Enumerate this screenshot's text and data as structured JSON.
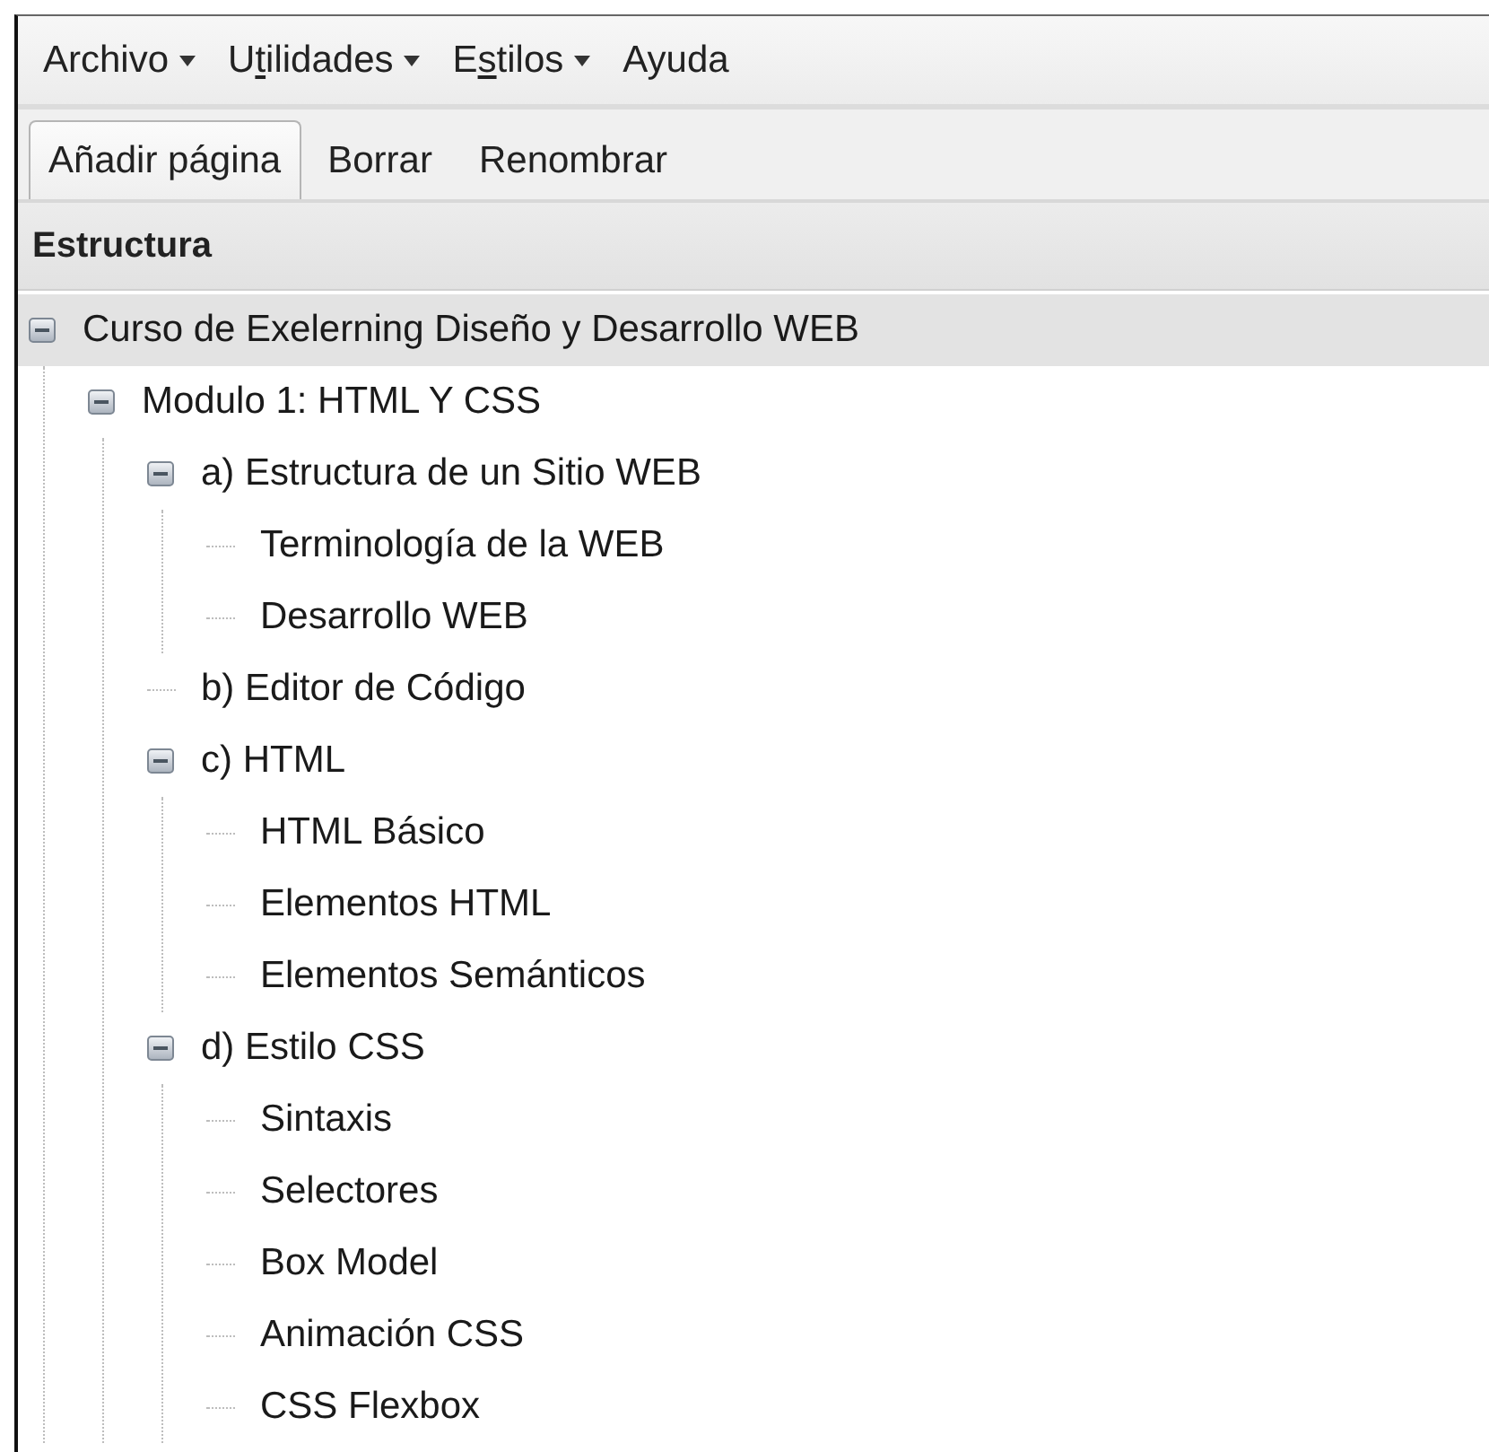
{
  "menu_bar": [
    {
      "label": "Archivo",
      "has_dropdown": true
    },
    {
      "label": "U",
      "mnemonic": "t",
      "label_rest": "ilidades",
      "has_dropdown": true
    },
    {
      "label": "E",
      "mnemonic": "s",
      "label_rest": "tilos",
      "has_dropdown": true
    },
    {
      "label": "Ayuda",
      "has_dropdown": false
    }
  ],
  "toolbar": [
    {
      "label": "Añadir página",
      "selected": true
    },
    {
      "label": "Borrar",
      "selected": false
    },
    {
      "label": "Renombrar",
      "selected": false
    }
  ],
  "panel": {
    "title": "Estructura"
  },
  "tree": [
    {
      "label": "Curso de Exelerning Diseño y Desarrollo WEB",
      "selected": true,
      "expanded": true,
      "children": [
        {
          "label": "Modulo 1: HTML Y CSS",
          "selected": false,
          "expanded": true,
          "children": [
            {
              "label": "a) Estructura de un Sitio WEB",
              "selected": false,
              "expanded": true,
              "children": [
                {
                  "label": "Terminología de la WEB",
                  "selected": false
                },
                {
                  "label": "Desarrollo WEB",
                  "selected": false
                }
              ]
            },
            {
              "label": "b) Editor de Código",
              "selected": false
            },
            {
              "label": "c) HTML",
              "selected": false,
              "expanded": true,
              "children": [
                {
                  "label": "HTML Básico",
                  "selected": false
                },
                {
                  "label": "Elementos HTML",
                  "selected": false
                },
                {
                  "label": "Elementos Semánticos",
                  "selected": false
                }
              ]
            },
            {
              "label": "d) Estilo CSS",
              "selected": false,
              "expanded": true,
              "children": [
                {
                  "label": "Sintaxis",
                  "selected": false
                },
                {
                  "label": "Selectores",
                  "selected": false
                },
                {
                  "label": "Box Model",
                  "selected": false
                },
                {
                  "label": "Animación CSS",
                  "selected": false
                },
                {
                  "label": "CSS Flexbox",
                  "selected": false
                }
              ]
            }
          ]
        }
      ]
    }
  ]
}
